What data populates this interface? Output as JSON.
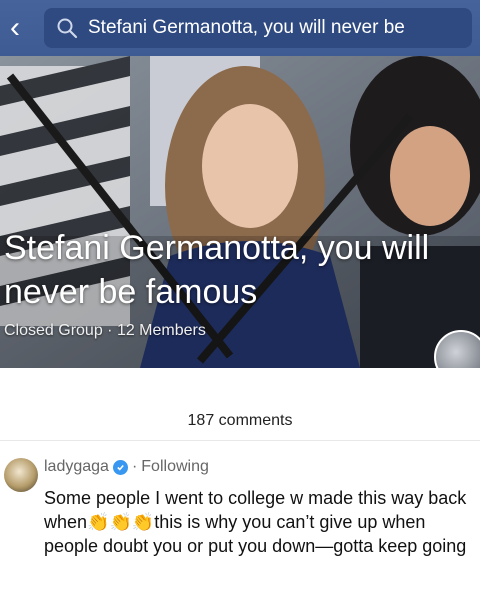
{
  "search": {
    "query": "Stefani Germanotta, you will never be"
  },
  "group": {
    "title_line1": "Stefani Germanotta, you will",
    "title_line2": "never be famous",
    "meta": "Closed Group · 12 Members"
  },
  "comments_count": "187 comments",
  "comment": {
    "username": "ladygaga",
    "separator": "·",
    "follow_status": "Following",
    "text_part1": "Some people I went to college w made this way back when",
    "emoji": "👏👏👏",
    "text_part2": "this is why you can’t give up when people doubt you or put you down—gotta keep going"
  },
  "colors": {
    "topbar": "#3f5b93",
    "verified": "#3897f0",
    "badge": "#ff2d55"
  }
}
